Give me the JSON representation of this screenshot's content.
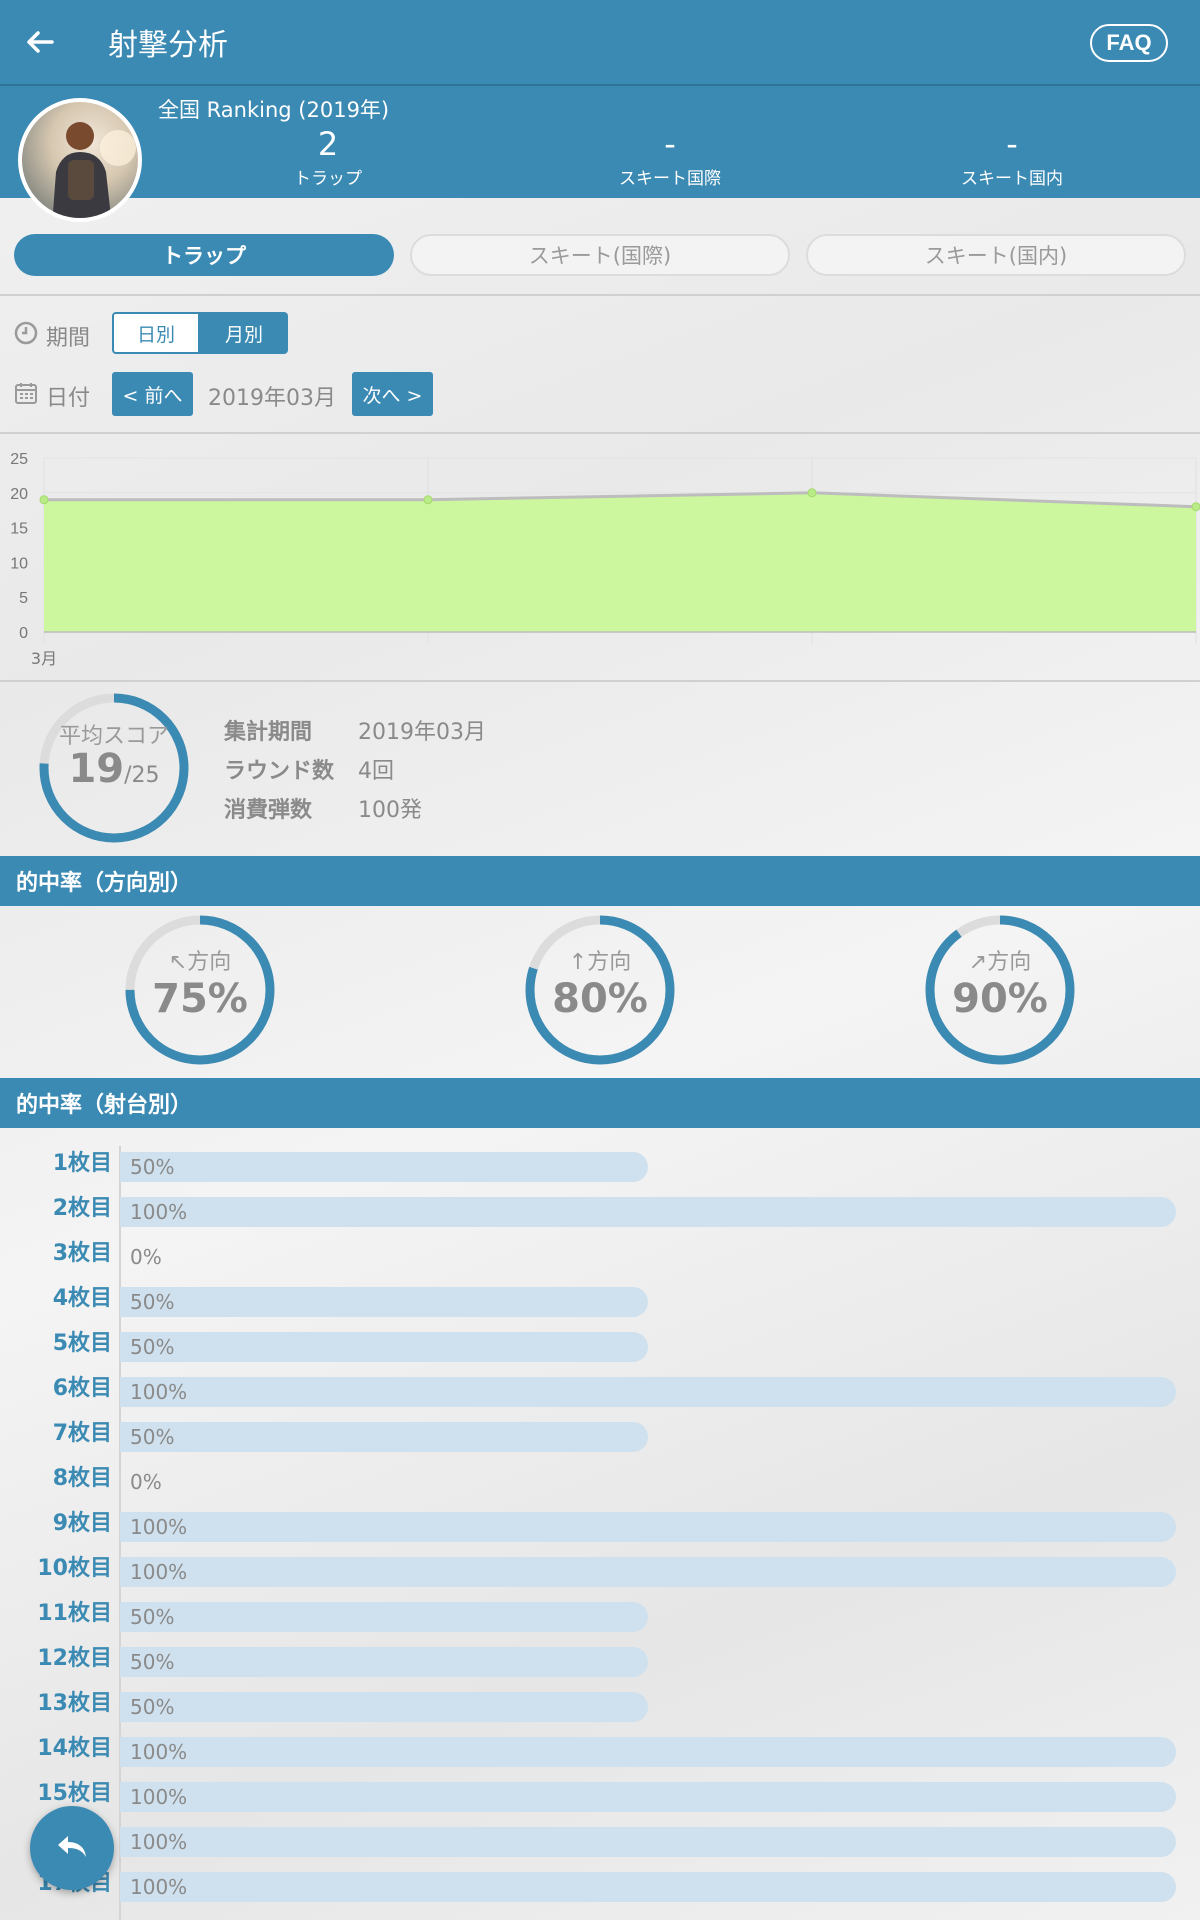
{
  "app": {
    "title": "射撃分析",
    "faq_label": "FAQ"
  },
  "profile": {
    "ranking_title": "全国 Ranking (2019年)",
    "rankings": [
      {
        "value": "2",
        "label": "トラップ"
      },
      {
        "value": "-",
        "label": "スキート国際"
      },
      {
        "value": "-",
        "label": "スキート国内"
      }
    ]
  },
  "tabs": [
    {
      "label": "トラップ",
      "active": true
    },
    {
      "label": "スキート(国際)",
      "active": false
    },
    {
      "label": "スキート(国内)",
      "active": false
    }
  ],
  "filters": {
    "period_label": "期間",
    "period_options": [
      "日別",
      "月別"
    ],
    "period_selected": "月別",
    "date_label": "日付",
    "prev_label": "< 前へ",
    "next_label": "次へ >",
    "date_value": "2019年03月"
  },
  "chart_data": {
    "type": "area",
    "x": [
      "3月",
      "",
      "",
      ""
    ],
    "values": [
      19,
      19,
      20,
      18
    ],
    "ylim": [
      0,
      25
    ],
    "yticks": [
      0,
      5,
      10,
      15,
      20,
      25
    ],
    "fill_color": "#ccf79f",
    "line_color": "#bdbdbd",
    "grid": true
  },
  "summary": {
    "gauge_label": "平均スコア",
    "score": "19",
    "max": "/25",
    "score_value": 19,
    "max_value": 25,
    "stats": [
      {
        "key": "集計期間",
        "value": "2019年03月"
      },
      {
        "key": "ラウンド数",
        "value": "4回"
      },
      {
        "key": "消費弾数",
        "value": "100発"
      }
    ]
  },
  "direction": {
    "header": "的中率（方向別）",
    "items": [
      {
        "label": "↖方向",
        "percent_text": "75%",
        "percent": 75
      },
      {
        "label": "↑方向",
        "percent_text": "80%",
        "percent": 80
      },
      {
        "label": "↗方向",
        "percent_text": "90%",
        "percent": 90
      }
    ]
  },
  "station": {
    "header": "的中率（射台別）",
    "rows": [
      {
        "label": "1枚目",
        "text": "50%",
        "percent": 50
      },
      {
        "label": "2枚目",
        "text": "100%",
        "percent": 100
      },
      {
        "label": "3枚目",
        "text": "0%",
        "percent": 0
      },
      {
        "label": "4枚目",
        "text": "50%",
        "percent": 50
      },
      {
        "label": "5枚目",
        "text": "50%",
        "percent": 50
      },
      {
        "label": "6枚目",
        "text": "100%",
        "percent": 100
      },
      {
        "label": "7枚目",
        "text": "50%",
        "percent": 50
      },
      {
        "label": "8枚目",
        "text": "0%",
        "percent": 0
      },
      {
        "label": "9枚目",
        "text": "100%",
        "percent": 100
      },
      {
        "label": "10枚目",
        "text": "100%",
        "percent": 100
      },
      {
        "label": "11枚目",
        "text": "50%",
        "percent": 50
      },
      {
        "label": "12枚目",
        "text": "50%",
        "percent": 50
      },
      {
        "label": "13枚目",
        "text": "50%",
        "percent": 50
      },
      {
        "label": "14枚目",
        "text": "100%",
        "percent": 100
      },
      {
        "label": "15枚目",
        "text": "100%",
        "percent": 100
      },
      {
        "label": "16枚目",
        "text": "100%",
        "percent": 100
      },
      {
        "label": "17枚目",
        "text": "100%",
        "percent": 100
      }
    ]
  },
  "colors": {
    "primary": "#3b8ab3",
    "track": "#dcdcdc",
    "bar": "#cfe1ee"
  }
}
